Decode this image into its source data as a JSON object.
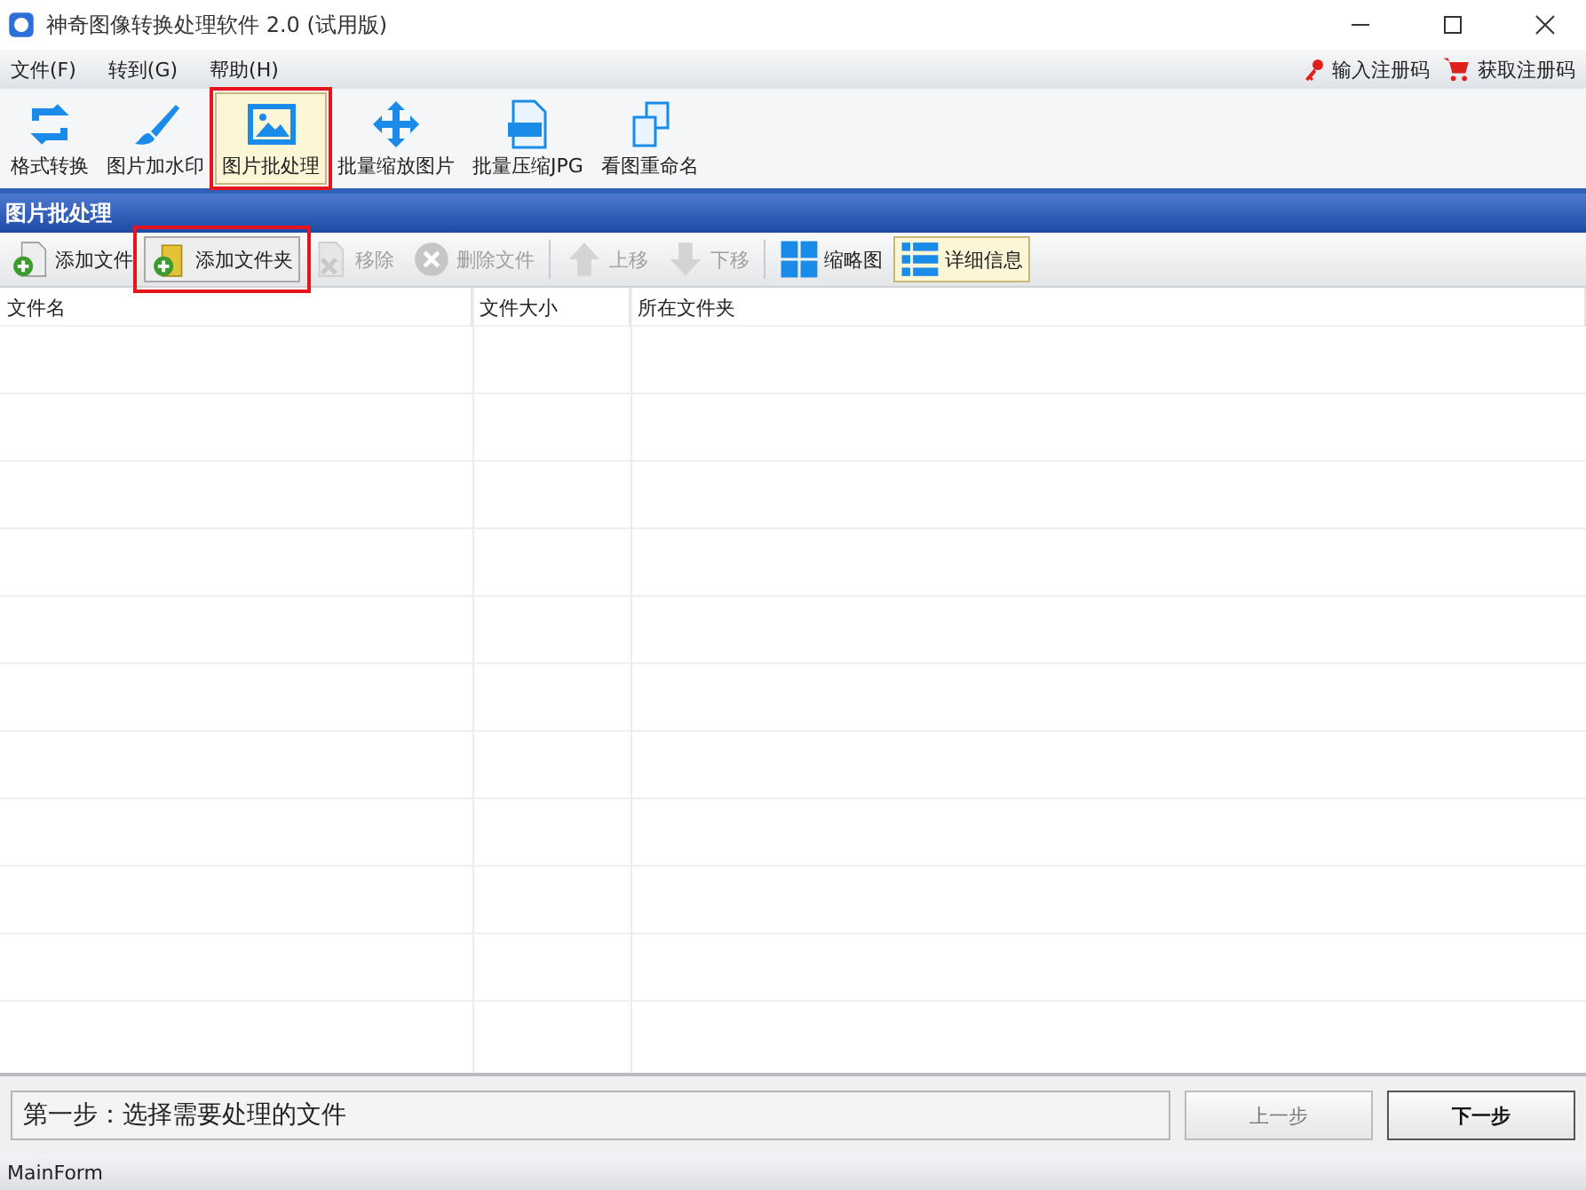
{
  "window": {
    "title": "神奇图像转换处理软件 2.0 (试用版)"
  },
  "menu": [
    {
      "label": "文件(F)"
    },
    {
      "label": "转到(G)"
    },
    {
      "label": "帮助(H)"
    }
  ],
  "register_links": [
    {
      "kind": "key",
      "label": "输入注册码"
    },
    {
      "kind": "cart",
      "label": "获取注册码"
    }
  ],
  "main_toolbar": [
    {
      "kind": "convert",
      "label": "格式转换",
      "selected": false,
      "annotated": false
    },
    {
      "kind": "brush",
      "label": "图片加水印",
      "selected": false,
      "annotated": false
    },
    {
      "kind": "image",
      "label": "图片批处理",
      "selected": true,
      "annotated": true
    },
    {
      "kind": "move",
      "label": "批量缩放图片",
      "selected": false,
      "annotated": false
    },
    {
      "kind": "jpg",
      "label": "批量压缩JPG",
      "selected": false,
      "annotated": false
    },
    {
      "kind": "rename",
      "label": "看图重命名",
      "selected": false,
      "annotated": false
    }
  ],
  "panel": {
    "title": "图片批处理"
  },
  "file_toolbar": [
    {
      "kind": "add-file",
      "label": "添加文件",
      "disabled": false,
      "selected": false,
      "annotated": false
    },
    {
      "kind": "add-folder",
      "label": "添加文件夹",
      "disabled": false,
      "selected": false,
      "annotated": true
    },
    {
      "kind": "remove",
      "label": "移除",
      "disabled": true,
      "selected": false,
      "annotated": false
    },
    {
      "kind": "delete",
      "label": "删除文件",
      "disabled": true,
      "selected": false,
      "annotated": false
    },
    {
      "kind": "up",
      "label": "上移",
      "disabled": true,
      "selected": false,
      "annotated": false
    },
    {
      "kind": "down",
      "label": "下移",
      "disabled": true,
      "selected": false,
      "annotated": false
    },
    {
      "kind": "grid",
      "label": "缩略图",
      "disabled": false,
      "selected": false,
      "annotated": false
    },
    {
      "kind": "list",
      "label": "详细信息",
      "disabled": false,
      "selected": true,
      "annotated": false
    }
  ],
  "table": {
    "columns": [
      "文件名",
      "文件大小",
      "所在文件夹"
    ]
  },
  "step": {
    "text": "第一步：选择需要处理的文件"
  },
  "buttons": [
    {
      "label": "上一步",
      "disabled": true
    },
    {
      "label": "下一步",
      "disabled": false
    }
  ],
  "status_bar": {
    "text": "MainForm"
  }
}
